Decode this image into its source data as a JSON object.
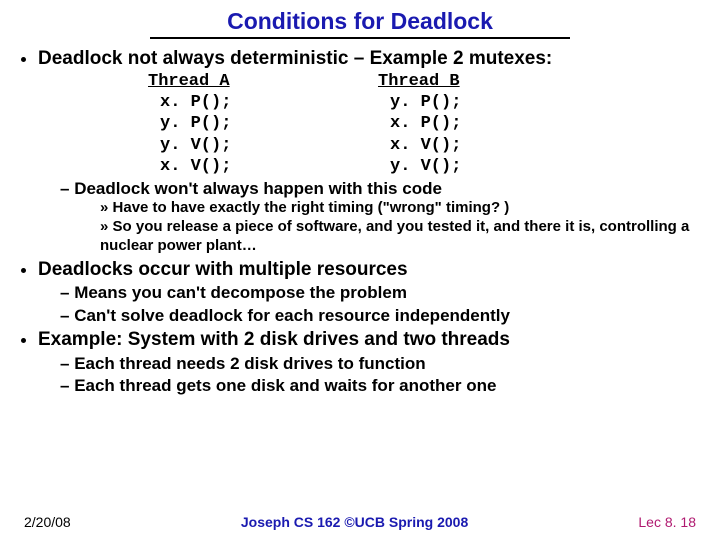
{
  "title": "Conditions for Deadlock",
  "bullet1": "Deadlock not always deterministic – Example 2 mutexes:",
  "threadA": {
    "title": "Thread A",
    "l1": "x. P();",
    "l2": "y. P();",
    "l3": "y. V();",
    "l4": "x. V();"
  },
  "threadB": {
    "title": "Thread B",
    "l1": "y. P();",
    "l2": "x. P();",
    "l3": "x. V();",
    "l4": "y. V();"
  },
  "sub1": "Deadlock won't always happen with this code",
  "subsub1": "Have to have exactly the right timing (\"wrong\" timing? )",
  "subsub2": "So you release a piece of software, and you tested it, and there it is, controlling a nuclear power plant…",
  "bullet2": "Deadlocks occur with multiple resources",
  "sub2a": "Means you can't decompose the problem",
  "sub2b": "Can't solve deadlock for each resource independently",
  "bullet3": "Example: System with 2 disk drives and two threads",
  "sub3a": "Each thread needs 2 disk drives to function",
  "sub3b": "Each thread gets one disk and waits for another one",
  "footer": {
    "date": "2/20/08",
    "mid": "Joseph CS 162 ©UCB Spring 2008",
    "lec": "Lec 8. 18"
  }
}
